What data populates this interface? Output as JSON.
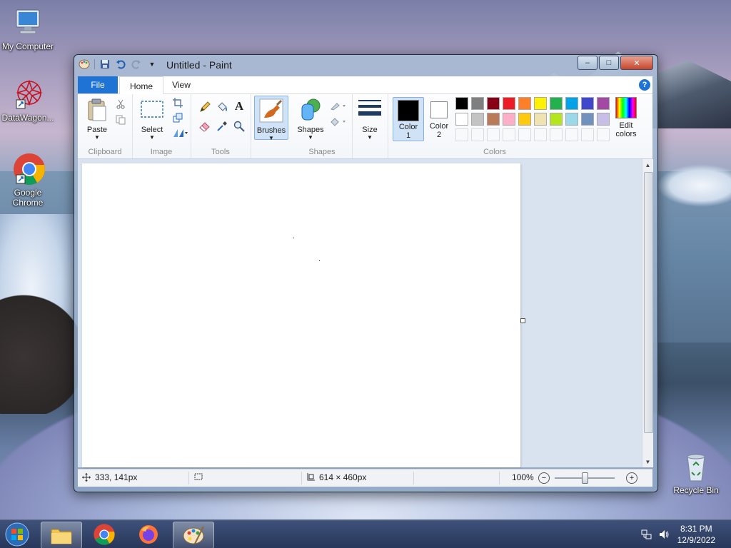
{
  "desktop": {
    "icons": [
      {
        "label": "My Computer"
      },
      {
        "label": "DataWagon..."
      },
      {
        "label": "Google Chrome"
      },
      {
        "label": "Recycle Bin"
      }
    ]
  },
  "window": {
    "title": "Untitled - Paint",
    "caption_buttons": {
      "minimize": "–",
      "maximize": "□",
      "close": "✕"
    }
  },
  "ribbon": {
    "tabs": [
      {
        "label": "File"
      },
      {
        "label": "Home",
        "active": true
      },
      {
        "label": "View"
      }
    ],
    "help": "?",
    "groups": {
      "clipboard": {
        "label": "Clipboard",
        "paste": "Paste"
      },
      "image": {
        "label": "Image",
        "select": "Select"
      },
      "tools": {
        "label": "Tools",
        "text_tool": "A"
      },
      "brushes": {
        "label": "Brushes"
      },
      "shapes": {
        "label": "Shapes",
        "button": "Shapes"
      },
      "size": {
        "label": "Size"
      },
      "colors": {
        "label": "Colors",
        "color1": "Color",
        "color1_num": "1",
        "color2": "Color",
        "color2_num": "2",
        "edit": "Edit",
        "edit2": "colors",
        "color1_value": "#000000",
        "color2_value": "#ffffff",
        "palette_row1": [
          "#000000",
          "#7f7f7f",
          "#880015",
          "#ed1c24",
          "#ff7f27",
          "#fff200",
          "#22b14c",
          "#00a2e8",
          "#3f48cc",
          "#a349a4"
        ],
        "palette_row2": [
          "#ffffff",
          "#c3c3c3",
          "#b97a57",
          "#ffaec9",
          "#ffc90e",
          "#efe4b0",
          "#b5e61d",
          "#99d9ea",
          "#7092be",
          "#c8bfe7"
        ]
      }
    }
  },
  "statusbar": {
    "cursor_pos": "333, 141px",
    "selection_size": "",
    "image_size": "614 × 460px",
    "zoom": "100%",
    "zoom_level": 1.0
  },
  "taskbar": {
    "time": "8:31 PM",
    "date": "12/9/2022"
  }
}
